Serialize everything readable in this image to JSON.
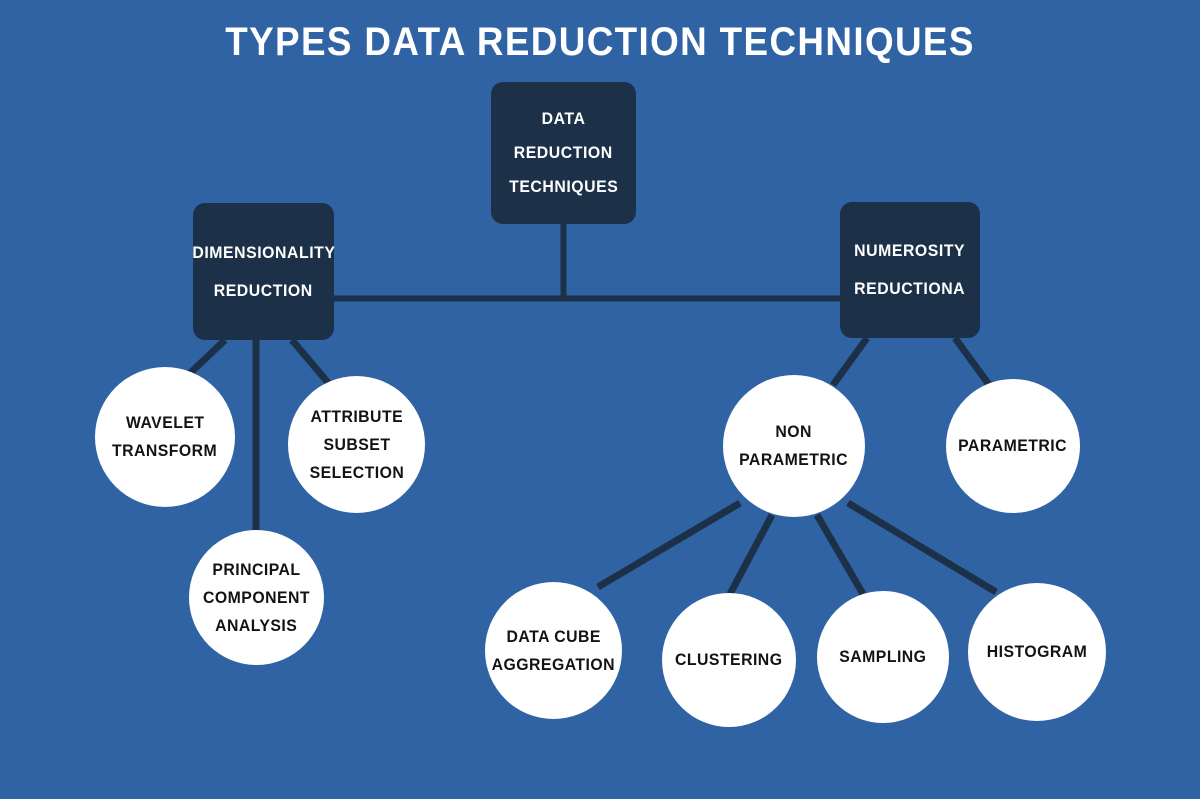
{
  "page": {
    "title": "TYPES  DATA REDUCTION TECHNIQUES",
    "background_color": "#2f63a4",
    "node_dark_color": "#1c3148",
    "node_light_color": "#ffffff",
    "connector_color": "#1c3148",
    "title_color": "#ffffff"
  },
  "diagram": {
    "type": "tree",
    "root": {
      "id": "root",
      "shape": "rounded-rect",
      "lines": [
        "DATA",
        "REDUCTION",
        "TECHNIQUES"
      ]
    },
    "branches": [
      {
        "id": "dimensionality-reduction",
        "shape": "rounded-rect",
        "lines": [
          "DIMENSIONALITY",
          "REDUCTION"
        ],
        "children": [
          {
            "id": "wavelet-transform",
            "shape": "circle",
            "lines": [
              "WAVELET",
              "TRANSFORM"
            ]
          },
          {
            "id": "principal-component-analysis",
            "shape": "circle",
            "lines": [
              "PRINCIPAL",
              "COMPONENT",
              "ANALYSIS"
            ]
          },
          {
            "id": "attribute-subset-selection",
            "shape": "circle",
            "lines": [
              "ATTRIBUTE",
              "SUBSET",
              "SELECTION"
            ]
          }
        ]
      },
      {
        "id": "numerosity-reductiona",
        "shape": "rounded-rect",
        "lines": [
          "NUMEROSITY",
          "REDUCTIONA"
        ],
        "children": [
          {
            "id": "non-parametric",
            "shape": "circle",
            "lines": [
              "NON",
              "PARAMETRIC"
            ],
            "children": [
              {
                "id": "data-cube-aggregation",
                "shape": "circle",
                "lines": [
                  "DATA  CUBE",
                  "AGGREGATION"
                ]
              },
              {
                "id": "clustering",
                "shape": "circle",
                "lines": [
                  "CLUSTERING"
                ]
              },
              {
                "id": "sampling",
                "shape": "circle",
                "lines": [
                  "SAMPLING"
                ]
              },
              {
                "id": "histogram",
                "shape": "circle",
                "lines": [
                  "HISTOGRAM"
                ]
              }
            ]
          },
          {
            "id": "parametric",
            "shape": "circle",
            "lines": [
              "PARAMETRIC"
            ]
          }
        ]
      }
    ]
  },
  "nodes": {
    "root": {
      "l1": "DATA",
      "l2": "REDUCTION",
      "l3": "TECHNIQUES"
    },
    "dimensionality": {
      "l1": "DIMENSIONALITY",
      "l2": "REDUCTION"
    },
    "numerosity": {
      "l1": "NUMEROSITY",
      "l2": "REDUCTIONA"
    },
    "wavelet": {
      "l1": "WAVELET",
      "l2": "TRANSFORM"
    },
    "attribute": {
      "l1": "ATTRIBUTE",
      "l2": "SUBSET",
      "l3": "SELECTION"
    },
    "pca": {
      "l1": "PRINCIPAL",
      "l2": "COMPONENT",
      "l3": "ANALYSIS"
    },
    "nonparametric": {
      "l1": "NON",
      "l2": "PARAMETRIC"
    },
    "parametric": {
      "l1": "PARAMETRIC"
    },
    "datacube": {
      "l1": "DATA  CUBE",
      "l2": "AGGREGATION"
    },
    "clustering": {
      "l1": "CLUSTERING"
    },
    "sampling": {
      "l1": "SAMPLING"
    },
    "histogram": {
      "l1": "HISTOGRAM"
    }
  }
}
